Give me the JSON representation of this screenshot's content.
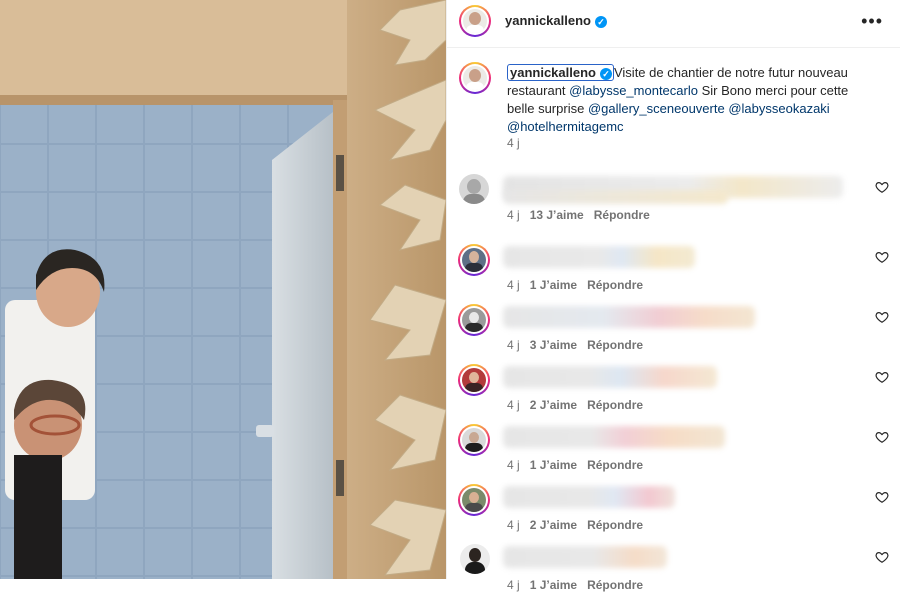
{
  "post": {
    "username": "yannickalleno",
    "more_icon": "more-horizontal-icon",
    "caption": {
      "username": "yannickalleno",
      "text_1": "Visite de chantier de notre futur nouveau restaurant ",
      "mention_1": "@labysse_montecarlo",
      "text_2": " Sir Bono merci pour cette belle surprise ",
      "mention_2": "@gallery_sceneouverte",
      "mention_3": "@labysseokazaki",
      "mention_4": "@hotelhermitagemc",
      "time": "4 j"
    }
  },
  "comments": [
    {
      "time": "4 j",
      "likes": "13 J’aime",
      "reply": "Répondre"
    },
    {
      "time": "4 j",
      "likes": "1 J’aime",
      "reply": "Répondre"
    },
    {
      "time": "4 j",
      "likes": "3 J’aime",
      "reply": "Répondre"
    },
    {
      "time": "4 j",
      "likes": "2 J’aime",
      "reply": "Répondre"
    },
    {
      "time": "4 j",
      "likes": "1 J’aime",
      "reply": "Répondre"
    },
    {
      "time": "4 j",
      "likes": "2 J’aime",
      "reply": "Répondre"
    },
    {
      "time": "4 j",
      "likes": "1 J’aime",
      "reply": "Répondre"
    }
  ],
  "colors": {
    "link": "#00376b",
    "verified": "#0095f6",
    "meta": "#737373",
    "highlight_box": "#2a63c8"
  }
}
